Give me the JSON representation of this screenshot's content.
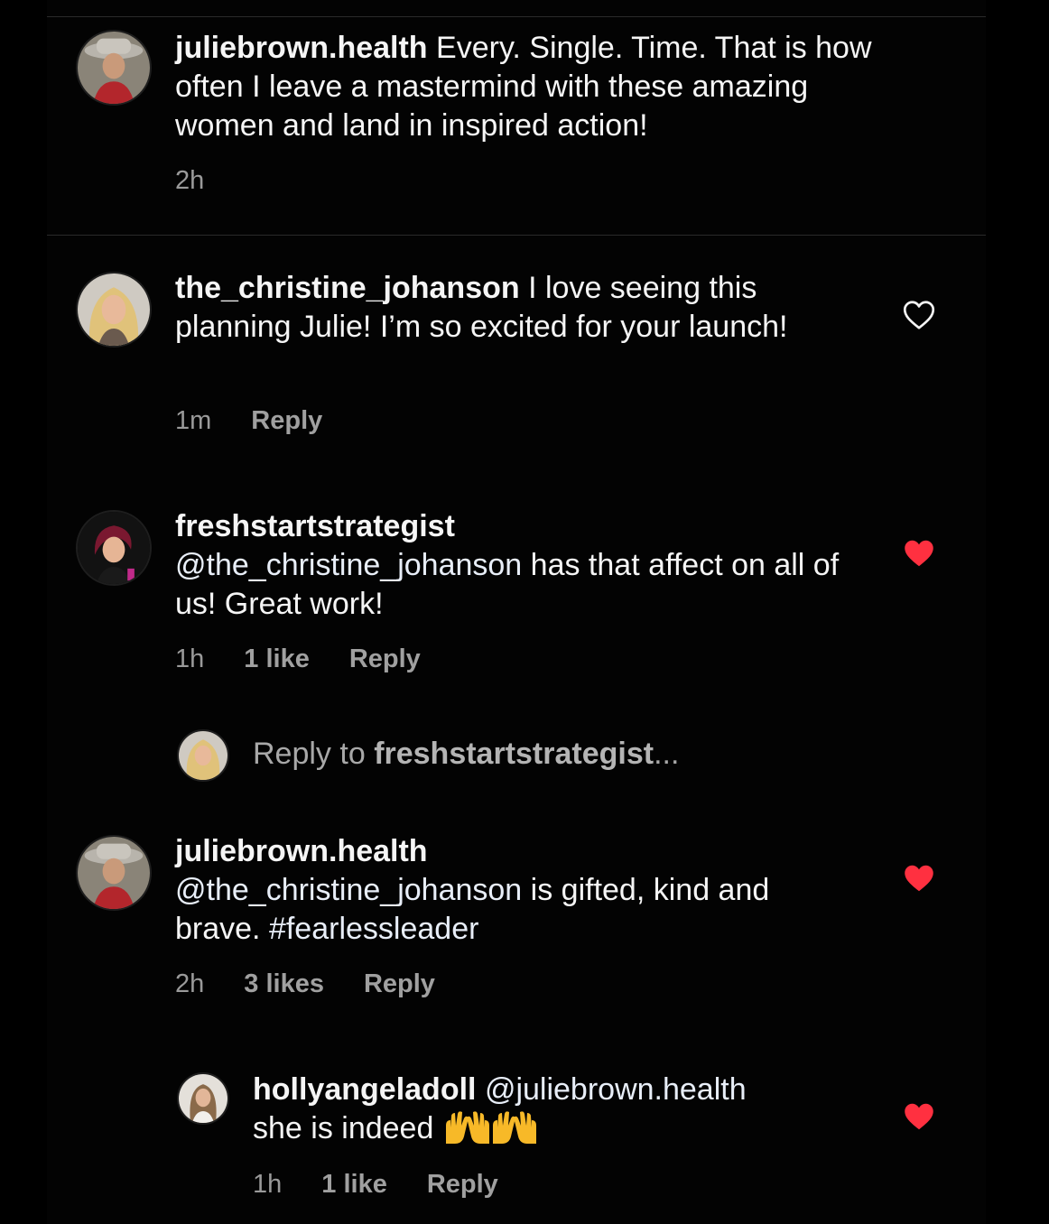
{
  "colors": {
    "background": "#000000",
    "text": "#f5f5f5",
    "muted": "#9a9a9a",
    "like_red": "#ff3040"
  },
  "comments": [
    {
      "username": "juliebrown.health",
      "text": "Every. Single. Time.  That is how often I leave a mastermind with these amazing women and land in inspired action!",
      "time": "2h"
    },
    {
      "username": "the_christine_johanson",
      "text": "I love seeing this planning Julie! I’m so excited for your launch!",
      "time": "1m",
      "reply_label": "Reply",
      "like_icon": "heart-outline-icon"
    },
    {
      "username": "freshstartstrategist",
      "mention": "@the_christine_johanson",
      "text": "has that affect on all of us! Great work!",
      "time": "1h",
      "likes": "1 like",
      "reply_label": "Reply",
      "like_icon": "heart-filled-icon"
    },
    {
      "username": "juliebrown.health",
      "mention": "@the_christine_johanson",
      "text": "is gifted, kind and brave.",
      "hashtag": "#fearlessleader",
      "time": "2h",
      "likes": "3 likes",
      "reply_label": "Reply",
      "like_icon": "heart-filled-icon"
    },
    {
      "username": "hollyangeladoll",
      "mention": "@juliebrown.health",
      "text": "she is indeed",
      "emoji": "raising-hands-icon",
      "time": "1h",
      "likes": "1 like",
      "reply_label": "Reply",
      "like_icon": "heart-filled-icon"
    }
  ],
  "reply_prompt": {
    "prefix": "Reply to",
    "username": "freshstartstrategist",
    "suffix": "..."
  }
}
